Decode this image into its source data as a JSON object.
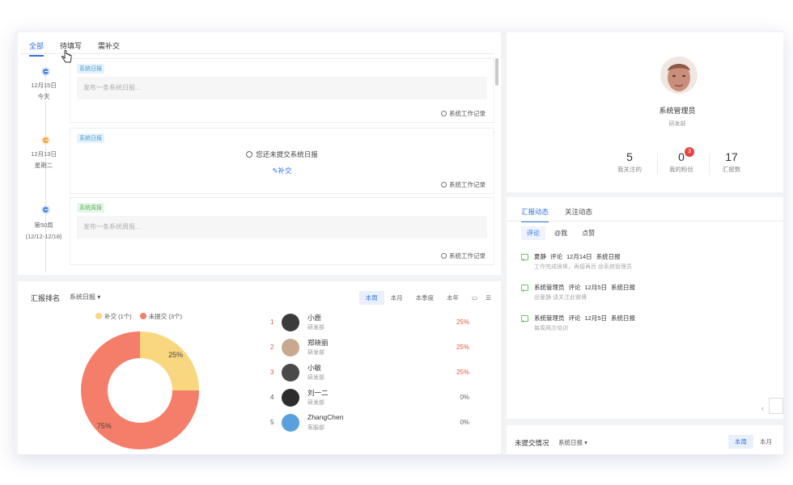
{
  "timeline": {
    "tabs": [
      "全部",
      "待填写",
      "需补交"
    ],
    "entries": [
      {
        "date": "12月15日",
        "day": "今天",
        "tag": "系统日报",
        "placeholder": "发布一条系统日报...",
        "footer": "系统工作记录",
        "color": "#4f86e8"
      },
      {
        "date": "12月13日",
        "day": "星期二",
        "tag": "系统日报",
        "notice": "您还未提交系统日报",
        "makeup": "补交",
        "footer": "系统工作记录",
        "color": "#f3a43a"
      },
      {
        "date": "第50周",
        "day": "(12/12-12/18)",
        "tag": "系统周报",
        "placeholder": "发布一条系统周报...",
        "footer": "系统工作记录",
        "color": "#4f86e8"
      }
    ]
  },
  "ranking": {
    "title": "汇报排名",
    "select": "系统日报 ▾",
    "periods": [
      "本周",
      "本月",
      "本季度",
      "本年"
    ],
    "legend": [
      {
        "label": "补交 (1个)",
        "color": "#f9d77e"
      },
      {
        "label": "未提交 (3个)",
        "color": "#f47e6a"
      }
    ],
    "rows": [
      {
        "rank": "1",
        "name": "小鹿",
        "dept": "研发部",
        "pct": "25%",
        "highlight": true,
        "avatar_color": "#3b3b3b"
      },
      {
        "rank": "2",
        "name": "郑晓丽",
        "dept": "研发部",
        "pct": "25%",
        "highlight": true,
        "avatar_color": "#c8a990"
      },
      {
        "rank": "3",
        "name": "小敏",
        "dept": "研发部",
        "pct": "25%",
        "highlight": true,
        "avatar_color": "#4a4a4a"
      },
      {
        "rank": "4",
        "name": "刘一二",
        "dept": "研发部",
        "pct": "0%",
        "highlight": false,
        "avatar_color": "#2d2d2d"
      },
      {
        "rank": "5",
        "name": "ZhangChen",
        "dept": "客服部",
        "pct": "0%",
        "highlight": false,
        "avatar_color": "#5aa0dc"
      }
    ]
  },
  "chart_data": {
    "type": "pie",
    "categories": [
      "补交",
      "未提交"
    ],
    "values": [
      25,
      75
    ],
    "labels": [
      "25%",
      "75%"
    ],
    "colors": [
      "#f9d77e",
      "#f47e6a"
    ],
    "legend_placement": "top"
  },
  "profile": {
    "name": "系统管理员",
    "dept": "研发部",
    "stats": [
      {
        "value": "5",
        "label": "我关注的"
      },
      {
        "value": "0",
        "label": "我的粉丝",
        "badge": "3"
      },
      {
        "value": "17",
        "label": "汇报数"
      }
    ]
  },
  "dynamics": {
    "tabs": [
      "汇报动态",
      "关注动态"
    ],
    "subtabs": [
      "评论",
      "@我",
      "点赞"
    ],
    "feed": [
      {
        "user": "夏静",
        "action": "评论",
        "date": "12月14日",
        "type": "系统日报",
        "detail": "工作完成很棒，再接再厉 @系统管理员"
      },
      {
        "user": "系统管理员",
        "action": "评论",
        "date": "12月5日",
        "type": "系统日报",
        "detail": "@夏静 请关注此微博"
      },
      {
        "user": "系统管理员",
        "action": "评论",
        "date": "12月5日",
        "type": "系统日报",
        "detail": "每周两次培训"
      }
    ],
    "pager_prev": "‹"
  },
  "unsubmitted": {
    "title": "未提交情况",
    "select": "系统日报 ▾",
    "periods": [
      "本周",
      "本月"
    ]
  }
}
